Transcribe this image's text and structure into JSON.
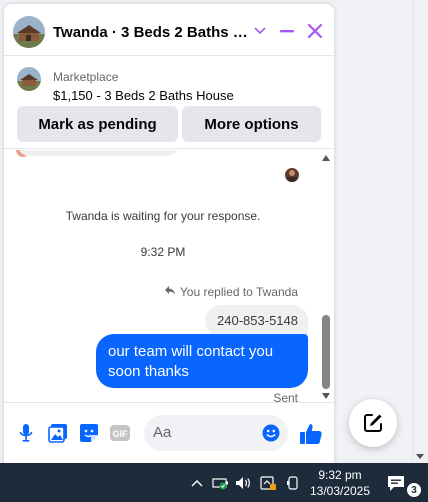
{
  "colors": {
    "accent": "#0866ff",
    "header_icon": "#a855f7",
    "bubble_incoming": "#f0f0f0",
    "taskbar": "#1d2b3a"
  },
  "chat": {
    "title": "Twanda · 3 Beds 2 Baths House",
    "marketplace_label": "Marketplace",
    "listing_title": "$1,150 - 3 Beds 2 Baths House",
    "mark_pending_label": "Mark as pending",
    "more_options_label": "More options"
  },
  "messages": {
    "waiting_notice": "Twanda is waiting for your response.",
    "timestamp": "9:32 PM",
    "replied_label": "You replied to Twanda",
    "quoted_text": "240-853-5148",
    "sent_text": "our team will contact you soon thanks",
    "status": "Sent"
  },
  "composer": {
    "placeholder": "Aa",
    "icons": [
      "microphone-icon",
      "image-icon",
      "sticker-icon",
      "gif-icon",
      "emoji-icon",
      "thumbs-up-icon"
    ]
  },
  "taskbar": {
    "time": "9:32 pm",
    "date": "13/03/2025",
    "notification_count": "3"
  }
}
